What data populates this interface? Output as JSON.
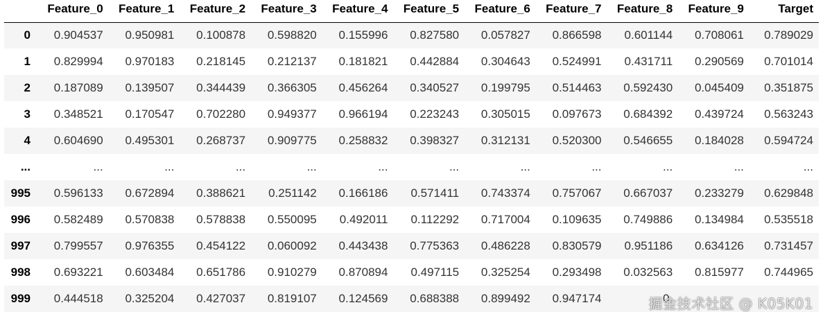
{
  "table": {
    "columns": [
      "",
      "Feature_0",
      "Feature_1",
      "Feature_2",
      "Feature_3",
      "Feature_4",
      "Feature_5",
      "Feature_6",
      "Feature_7",
      "Feature_8",
      "Feature_9",
      "Target"
    ],
    "rows": [
      {
        "index": "0",
        "cells": [
          "0.904537",
          "0.950981",
          "0.100878",
          "0.598820",
          "0.155996",
          "0.827580",
          "0.057827",
          "0.866598",
          "0.601144",
          "0.708061",
          "0.789029"
        ]
      },
      {
        "index": "1",
        "cells": [
          "0.829994",
          "0.970183",
          "0.218145",
          "0.212137",
          "0.181821",
          "0.442884",
          "0.304643",
          "0.524991",
          "0.431711",
          "0.290569",
          "0.701014"
        ]
      },
      {
        "index": "2",
        "cells": [
          "0.187089",
          "0.139507",
          "0.344439",
          "0.366305",
          "0.456264",
          "0.340527",
          "0.199795",
          "0.514463",
          "0.592430",
          "0.045409",
          "0.351875"
        ]
      },
      {
        "index": "3",
        "cells": [
          "0.348521",
          "0.170547",
          "0.702280",
          "0.949377",
          "0.966194",
          "0.223243",
          "0.305015",
          "0.097673",
          "0.684392",
          "0.439724",
          "0.563243"
        ]
      },
      {
        "index": "4",
        "cells": [
          "0.604690",
          "0.495301",
          "0.268737",
          "0.909775",
          "0.258832",
          "0.398327",
          "0.312131",
          "0.520300",
          "0.546655",
          "0.184028",
          "0.594724"
        ]
      },
      {
        "index": "...",
        "cells": [
          "...",
          "...",
          "...",
          "...",
          "...",
          "...",
          "...",
          "...",
          "...",
          "...",
          "..."
        ]
      },
      {
        "index": "995",
        "cells": [
          "0.596133",
          "0.672894",
          "0.388621",
          "0.251142",
          "0.166186",
          "0.571411",
          "0.743374",
          "0.757067",
          "0.667037",
          "0.233279",
          "0.629848"
        ]
      },
      {
        "index": "996",
        "cells": [
          "0.582489",
          "0.570838",
          "0.578838",
          "0.550095",
          "0.492011",
          "0.112292",
          "0.717004",
          "0.109635",
          "0.749886",
          "0.134984",
          "0.535518"
        ]
      },
      {
        "index": "997",
        "cells": [
          "0.799557",
          "0.976355",
          "0.454122",
          "0.060092",
          "0.443438",
          "0.775363",
          "0.486228",
          "0.830579",
          "0.951186",
          "0.634126",
          "0.731457"
        ]
      },
      {
        "index": "998",
        "cells": [
          "0.693221",
          "0.603484",
          "0.651786",
          "0.910279",
          "0.870894",
          "0.497115",
          "0.325254",
          "0.293498",
          "0.032563",
          "0.815977",
          "0.744965"
        ]
      },
      {
        "index": "999",
        "cells": [
          "0.444518",
          "0.325204",
          "0.427037",
          "0.819107",
          "0.124569",
          "0.688388",
          "0.899492",
          "0.947174",
          "0.",
          "",
          ""
        ]
      }
    ]
  },
  "watermark": {
    "text": "掘金技术社区 @ K05K01"
  }
}
